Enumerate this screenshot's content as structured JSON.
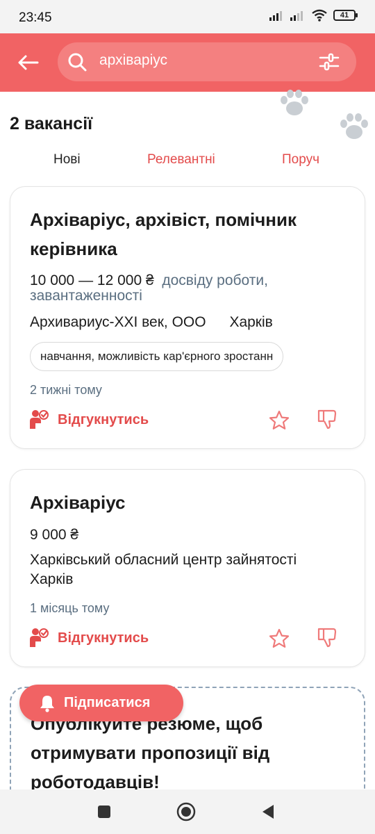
{
  "status_bar": {
    "time": "23:45",
    "battery": "41"
  },
  "search": {
    "query": "архіваріус"
  },
  "results": {
    "count_label": "2 вакансії"
  },
  "sort_tabs": [
    {
      "label": "Нові"
    },
    {
      "label": "Релевантні"
    },
    {
      "label": "Поруч"
    }
  ],
  "vacancies": [
    {
      "title": "Архіваріус, архівіст, помічник керівника",
      "salary": "10 000 — 12 000 ₴",
      "salary_note": "досвіду роботи, завантаженності",
      "company": "Архивариус-XXI век, ООО",
      "city": "Харків",
      "tag": "навчання, можливість кар'єрного зростанн",
      "posted": "2 тижні тому",
      "apply_label": "Відгукнутись"
    },
    {
      "title": "Архіваріус",
      "salary": "9 000 ₴",
      "company": "Харківський обласний центр зайнятості",
      "city": "Харків",
      "posted": "1 місяць тому",
      "apply_label": "Відгукнутись"
    }
  ],
  "promo": {
    "text": "Опублікуйте резюме, щоб отримувати пропозиції від роботодавців!"
  },
  "subscribe": {
    "label": "Підписатися"
  },
  "colors": {
    "brand": "#f16364",
    "accent_text": "#e34b4b",
    "muted_text": "#5a6e80"
  }
}
